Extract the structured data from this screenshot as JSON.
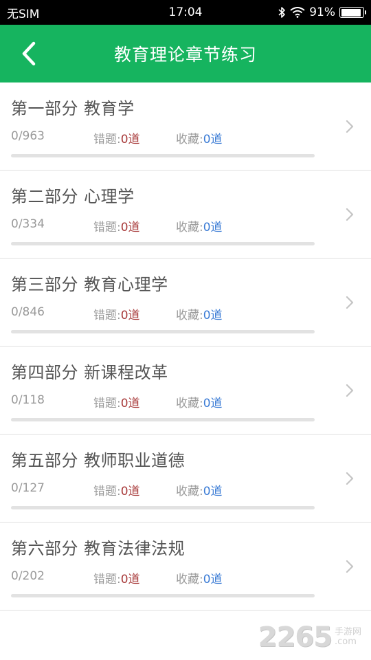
{
  "status_bar": {
    "carrier": "无SIM",
    "time": "17:04",
    "battery_percent": "91%",
    "battery_level": 0.91,
    "bluetooth_icon": "bluetooth-icon",
    "wifi_icon": "wifi-icon"
  },
  "nav": {
    "title": "教育理论章节练习",
    "back_icon": "chevron-left-icon",
    "background_color": "#16b45f"
  },
  "labels": {
    "wrong": "错题:",
    "favorite": "收藏:"
  },
  "colors": {
    "wrong_value": "#a83a3a",
    "favorite_value": "#3a7bd5",
    "progress_fill": "#16b45f"
  },
  "items": [
    {
      "title": "第一部分  教育学",
      "progress": "0/963",
      "done": 0,
      "total": 963,
      "wrong_count": "0道",
      "fav_count": "0道"
    },
    {
      "title": "第二部分  心理学",
      "progress": "0/334",
      "done": 0,
      "total": 334,
      "wrong_count": "0道",
      "fav_count": "0道"
    },
    {
      "title": "第三部分  教育心理学",
      "progress": "0/846",
      "done": 0,
      "total": 846,
      "wrong_count": "0道",
      "fav_count": "0道"
    },
    {
      "title": "第四部分  新课程改革",
      "progress": "0/118",
      "done": 0,
      "total": 118,
      "wrong_count": "0道",
      "fav_count": "0道"
    },
    {
      "title": "第五部分  教师职业道德",
      "progress": "0/127",
      "done": 0,
      "total": 127,
      "wrong_count": "0道",
      "fav_count": "0道"
    },
    {
      "title": "第六部分  教育法律法规",
      "progress": "0/202",
      "done": 0,
      "total": 202,
      "wrong_count": "0道",
      "fav_count": "0道"
    }
  ],
  "watermark": {
    "number": "2265",
    "text_line1": "手游网",
    "text_line2": ".com"
  }
}
